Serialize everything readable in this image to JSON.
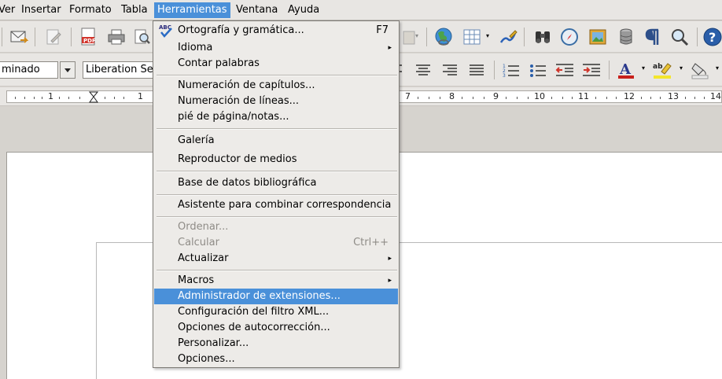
{
  "menubar": {
    "items": [
      "Ver",
      "Insertar",
      "Formato",
      "Tabla",
      "Herramientas",
      "Ventana",
      "Ayuda"
    ],
    "active": "Herramientas"
  },
  "format_bar": {
    "style_value": "minado",
    "font_value": "Liberation Se"
  },
  "ruler": {
    "left_labels": [
      "1",
      "1"
    ],
    "right_labels": [
      "7",
      "8",
      "9",
      "10",
      "11",
      "12",
      "13",
      "14"
    ]
  },
  "tools_menu": {
    "spelling": {
      "label": "Ortografía y gramática...",
      "shortcut": "F7"
    },
    "language": {
      "label": "Idioma"
    },
    "word_count": {
      "label": "Contar palabras"
    },
    "chapter_numbering": {
      "label": "Numeración de capítulos..."
    },
    "line_numbering": {
      "label": "Numeración de líneas..."
    },
    "footnotes": {
      "label": "pié de página/notas..."
    },
    "gallery": {
      "label": "Galería"
    },
    "media_player": {
      "label": "Reproductor de medios"
    },
    "bibliography": {
      "label": "Base de datos bibliográfica"
    },
    "mail_merge": {
      "label": "Asistente para combinar correspondencia"
    },
    "sort": {
      "label": "Ordenar..."
    },
    "calculate": {
      "label": "Calcular",
      "shortcut": "Ctrl++"
    },
    "update": {
      "label": "Actualizar"
    },
    "macros": {
      "label": "Macros"
    },
    "extension_manager": {
      "label": "Administrador de extensiones..."
    },
    "xml_filter": {
      "label": "Configuración del filtro XML..."
    },
    "autocorrect": {
      "label": "Opciones de autocorrección..."
    },
    "customize": {
      "label": "Personalizar..."
    },
    "options": {
      "label": "Opciones..."
    }
  },
  "colors": {
    "highlight": "#4a90d9",
    "menu_bg": "#edebe8"
  }
}
